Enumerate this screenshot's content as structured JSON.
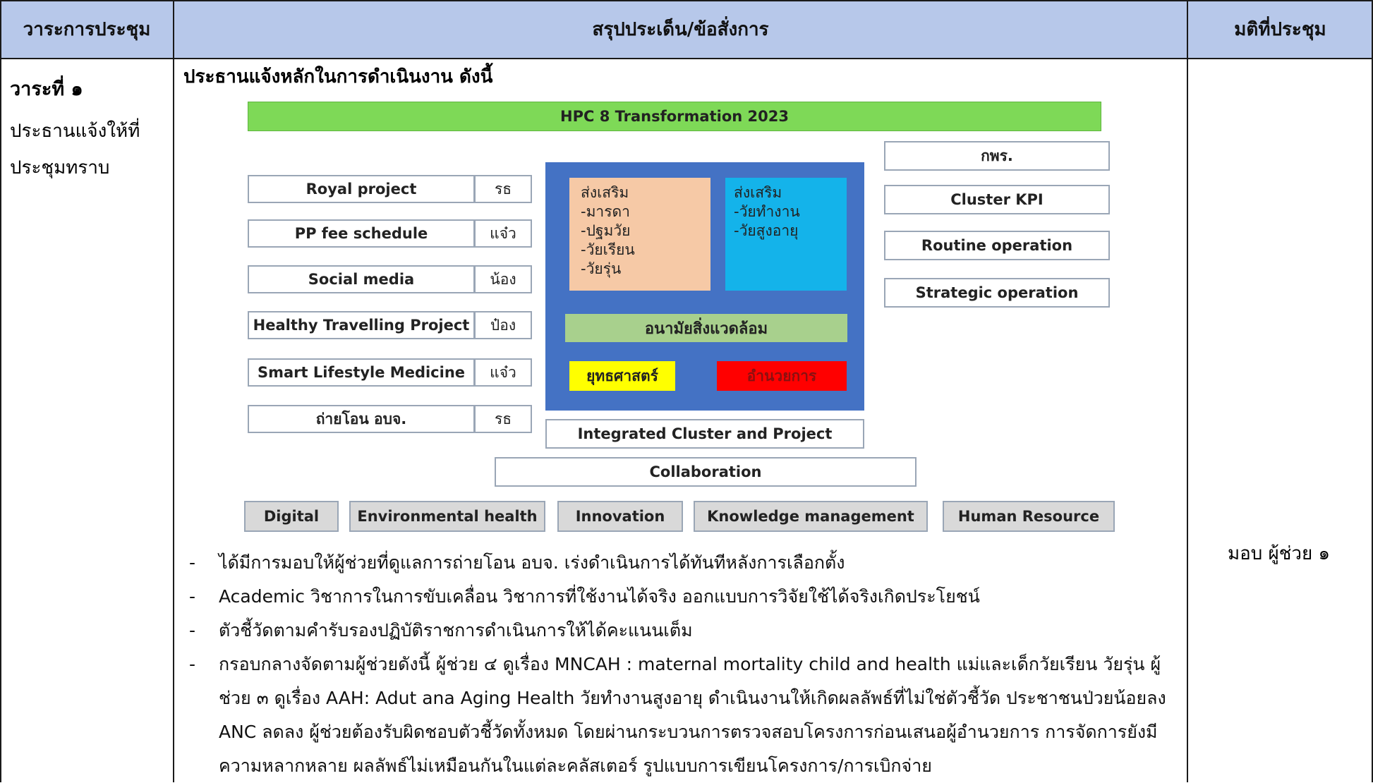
{
  "header": {
    "col_agenda": "วาระการประชุม",
    "col_summary": "สรุปประเด็น/ข้อสั่งการ",
    "col_resolution": "มติที่ประชุม"
  },
  "agenda": {
    "title": "วาระที่ ๑",
    "description": "ประธานแจ้งให้ที่ประชุมทราบ"
  },
  "summary": {
    "heading": "ประธานแจ้งหลักในการดำเนินงาน ดังนี้"
  },
  "diagram": {
    "banner": "HPC 8 Transformation 2023",
    "left_items": [
      {
        "label": "Royal project",
        "owner": "รธ"
      },
      {
        "label": "PP fee schedule",
        "owner": "แจ๋ว"
      },
      {
        "label": "Social media",
        "owner": "น้อง"
      },
      {
        "label": "Healthy Travelling Project",
        "owner": "ป๋อง"
      },
      {
        "label": "Smart Lifestyle Medicine",
        "owner": "แจ๋ว"
      },
      {
        "label": "ถ่ายโอน อบจ.",
        "owner": "รธ"
      }
    ],
    "promote_left": {
      "title": "ส่งเสริม",
      "lines": [
        "-มารดา",
        "-ปฐมวัย",
        "-วัยเรียน",
        "-วัยรุ่น"
      ]
    },
    "promote_right": {
      "title": "ส่งเสริม",
      "lines": [
        "-วัยทำงาน",
        "-วัยสูงอายุ"
      ]
    },
    "environment": "อนามัยสิ่งแวดล้อม",
    "strategy": "ยุทธศาสตร์",
    "admin": "อำนวยการ",
    "right_items": [
      "กพร.",
      "Cluster KPI",
      "Routine operation",
      "Strategic operation"
    ],
    "integrated": "Integrated Cluster and Project",
    "collaboration": "Collaboration",
    "bottom_items": [
      "Digital",
      "Environmental health",
      "Innovation",
      "Knowledge management",
      "Human Resource"
    ]
  },
  "bullets": [
    "ได้มีการมอบให้ผู้ช่วยที่ดูแลการถ่ายโอน อบจ. เร่งดำเนินการได้ทันทีหลังการเลือกตั้ง",
    "Academic วิชาการในการขับเคลื่อน วิชาการที่ใช้งานได้จริง ออกแบบการวิจัยใช้ได้จริงเกิดประโยชน์",
    "ตัวชี้วัดตามคำรับรองปฏิบัติราชการดำเนินการให้ได้คะแนนเต็ม",
    "กรอบกลางจัดตามผู้ช่วยดังนี้ ผู้ช่วย ๔ ดูเรื่อง MNCAH : maternal mortality child and health แม่และเด็กวัยเรียน วัยรุ่น ผู้ช่วย ๓ ดูเรื่อง AAH: Adut ana Aging Health วัยทำงานสูงอายุ ดำเนินงานให้เกิดผลลัพธ์ที่ไม่ใช่ตัวชี้วัด ประชาชนป่วยน้อยลง ANC ลดลง ผู้ช่วยต้องรับผิดชอบตัวชี้วัดทั้งหมด โดยผ่านกระบวนการตรวจสอบโครงการก่อนเสนอผู้อำนวยการ การจัดการยังมีความหลากหลาย ผลลัพธ์ไม่เหมือนกันในแต่ละคลัสเตอร์ รูปแบบการเขียนโครงการ/การเบิกจ่าย"
  ],
  "resolution": {
    "text": "มอบ ผู้ช่วย ๑"
  }
}
